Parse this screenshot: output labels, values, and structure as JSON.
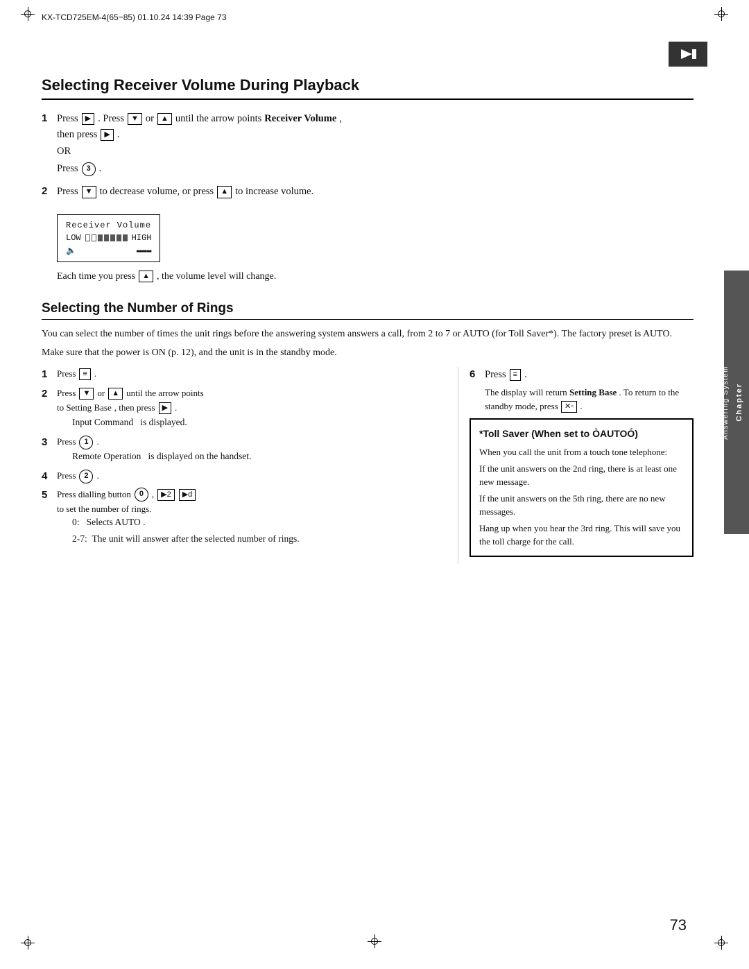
{
  "header": {
    "left_text": "KX-TCD725EM-4(65~85)  01.10.24  14:39  Page  73"
  },
  "section1": {
    "title": "Selecting Receiver Volume During Playback",
    "steps": [
      {
        "num": "1",
        "text": "Press",
        "text2": ". Press",
        "text3": "or",
        "text4": "until the arrow points",
        "text5": "Receiver Volume",
        "text6": ", then press",
        "text7": ".",
        "line2": "OR",
        "line3": "Press",
        "line3b": "."
      },
      {
        "num": "2",
        "text": "Press",
        "text2": "to decrease volume, or press",
        "text3": "to increase volume."
      }
    ],
    "display": {
      "label": "Receiver Volume",
      "low": "LOW",
      "high": "HIGH",
      "bar_caption": "Each time you press",
      "bar_caption2": ", the volume level will change."
    }
  },
  "section2": {
    "title": "Selecting the Number of Rings",
    "intro1": "You can select the number of times the unit rings before the answering system answers a call, from 2 to 7 or AUTO (for Toll Saver*). The factory preset is AUTO.",
    "intro2": "Make sure that the power is ON (p. 12), and the unit is in the standby mode.",
    "steps_left": [
      {
        "num": "1",
        "text": "Press",
        "btn": "MENU",
        "end": "."
      },
      {
        "num": "2",
        "text": "Press",
        "btn": "▼",
        "text2": "or",
        "btn2": "▲",
        "text3": "until the arrow points to  Setting Base",
        "btn3": "▶",
        "end": ",  then press",
        "end2": ".",
        "sub": "Input Command    is displayed."
      },
      {
        "num": "3",
        "text": "Press",
        "btn": "1",
        "end": ".",
        "sub": "Remote Operation    is displayed on the handset."
      },
      {
        "num": "4",
        "text": "Press",
        "btn": "2",
        "end": "."
      },
      {
        "num": "5",
        "text": "Press dialling button",
        "btn": "0",
        "sep": ",",
        "btn2": "▶2",
        "sep2": "",
        "btn3": "▶d",
        "end": "to set the number of rings.",
        "sub0": "0:   Selects  AUTO  .",
        "sub1": "2-7:  The unit will answer after the selected number of rings."
      }
    ],
    "steps_right": [
      {
        "num": "6",
        "text": "Press",
        "btn": "MENU",
        "end": ".",
        "sub": "The display will return Setting Base . To return to the standby mode, press",
        "sub_btn": "✕◦",
        "sub_end": "."
      }
    ],
    "toll_saver": {
      "title": "*Toll Saver (When set to ÒAUTOÓ)",
      "lines": [
        "When you call the unit from a touch tone telephone:",
        "If the unit answers on the 2nd ring, there is at least one new message.",
        "If the unit answers on the 5th ring, there are no new messages.",
        "Hang up when you hear the 3rd ring. This will save you the toll charge for the call."
      ]
    }
  },
  "chapter_tab": {
    "chapter": "Chapter",
    "subtitle": "Answering System"
  },
  "page_number": "73"
}
